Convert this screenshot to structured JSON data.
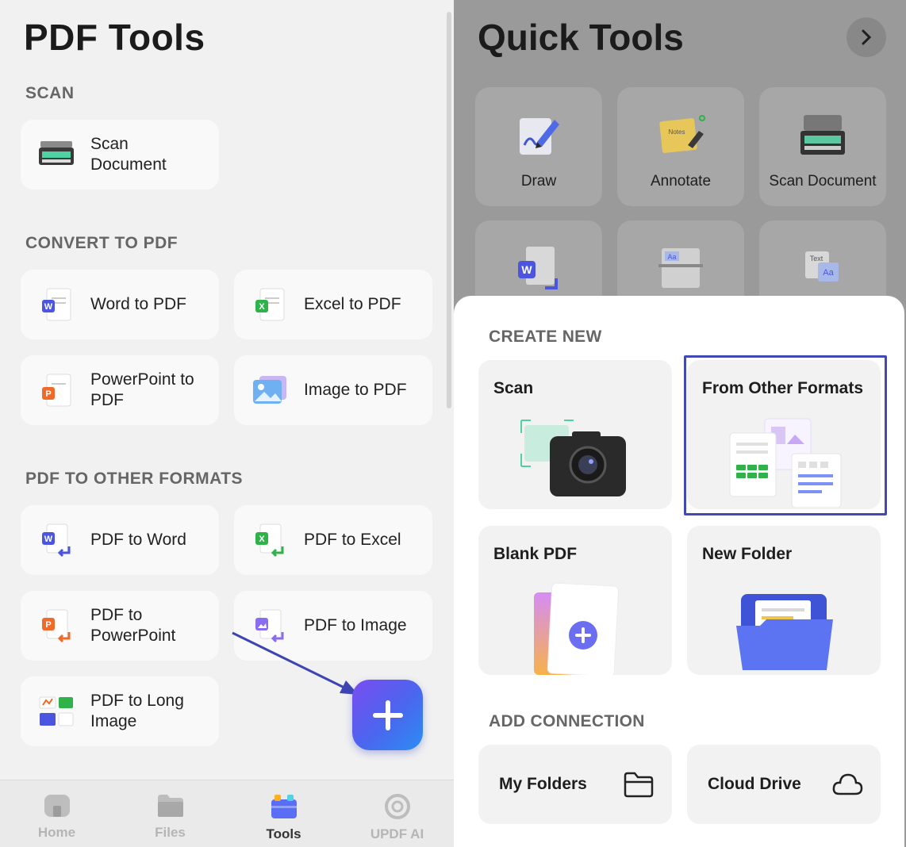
{
  "left": {
    "title": "PDF Tools",
    "sections": {
      "scan": "SCAN",
      "convert": "CONVERT TO PDF",
      "other": "PDF TO OTHER FORMATS"
    },
    "tools": {
      "scan_document": "Scan\nDocument",
      "word_to_pdf": "Word to PDF",
      "excel_to_pdf": "Excel to PDF",
      "ppt_to_pdf": "PowerPoint to\nPDF",
      "image_to_pdf": "Image to PDF",
      "pdf_to_word": "PDF to Word",
      "pdf_to_excel": "PDF to Excel",
      "pdf_to_ppt": "PDF to\nPowerPoint",
      "pdf_to_image": "PDF to Image",
      "pdf_to_long_image": "PDF to Long\nImage"
    },
    "tabs": {
      "home": "Home",
      "files": "Files",
      "tools": "Tools",
      "ai": "UPDF AI",
      "active": "Tools"
    },
    "fab_icon": "plus-icon"
  },
  "right": {
    "title": "Quick Tools",
    "quick_tools": {
      "draw": "Draw",
      "annotate": "Annotate",
      "scan_document": "Scan Document"
    },
    "annotate_note": "Notes",
    "sheet": {
      "create_new": "CREATE NEW",
      "scan": "Scan",
      "from_other": "From Other Formats",
      "blank_pdf": "Blank PDF",
      "new_folder": "New Folder",
      "add_connection": "ADD CONNECTION",
      "my_folders": "My Folders",
      "cloud_drive": "Cloud Drive"
    }
  },
  "colors": {
    "accent": "#4149b4",
    "fab_start": "#7a4cf0",
    "fab_end": "#2b8df3",
    "word": "#4b55e0",
    "excel": "#2fb24a",
    "powerpoint": "#f06a2a"
  }
}
